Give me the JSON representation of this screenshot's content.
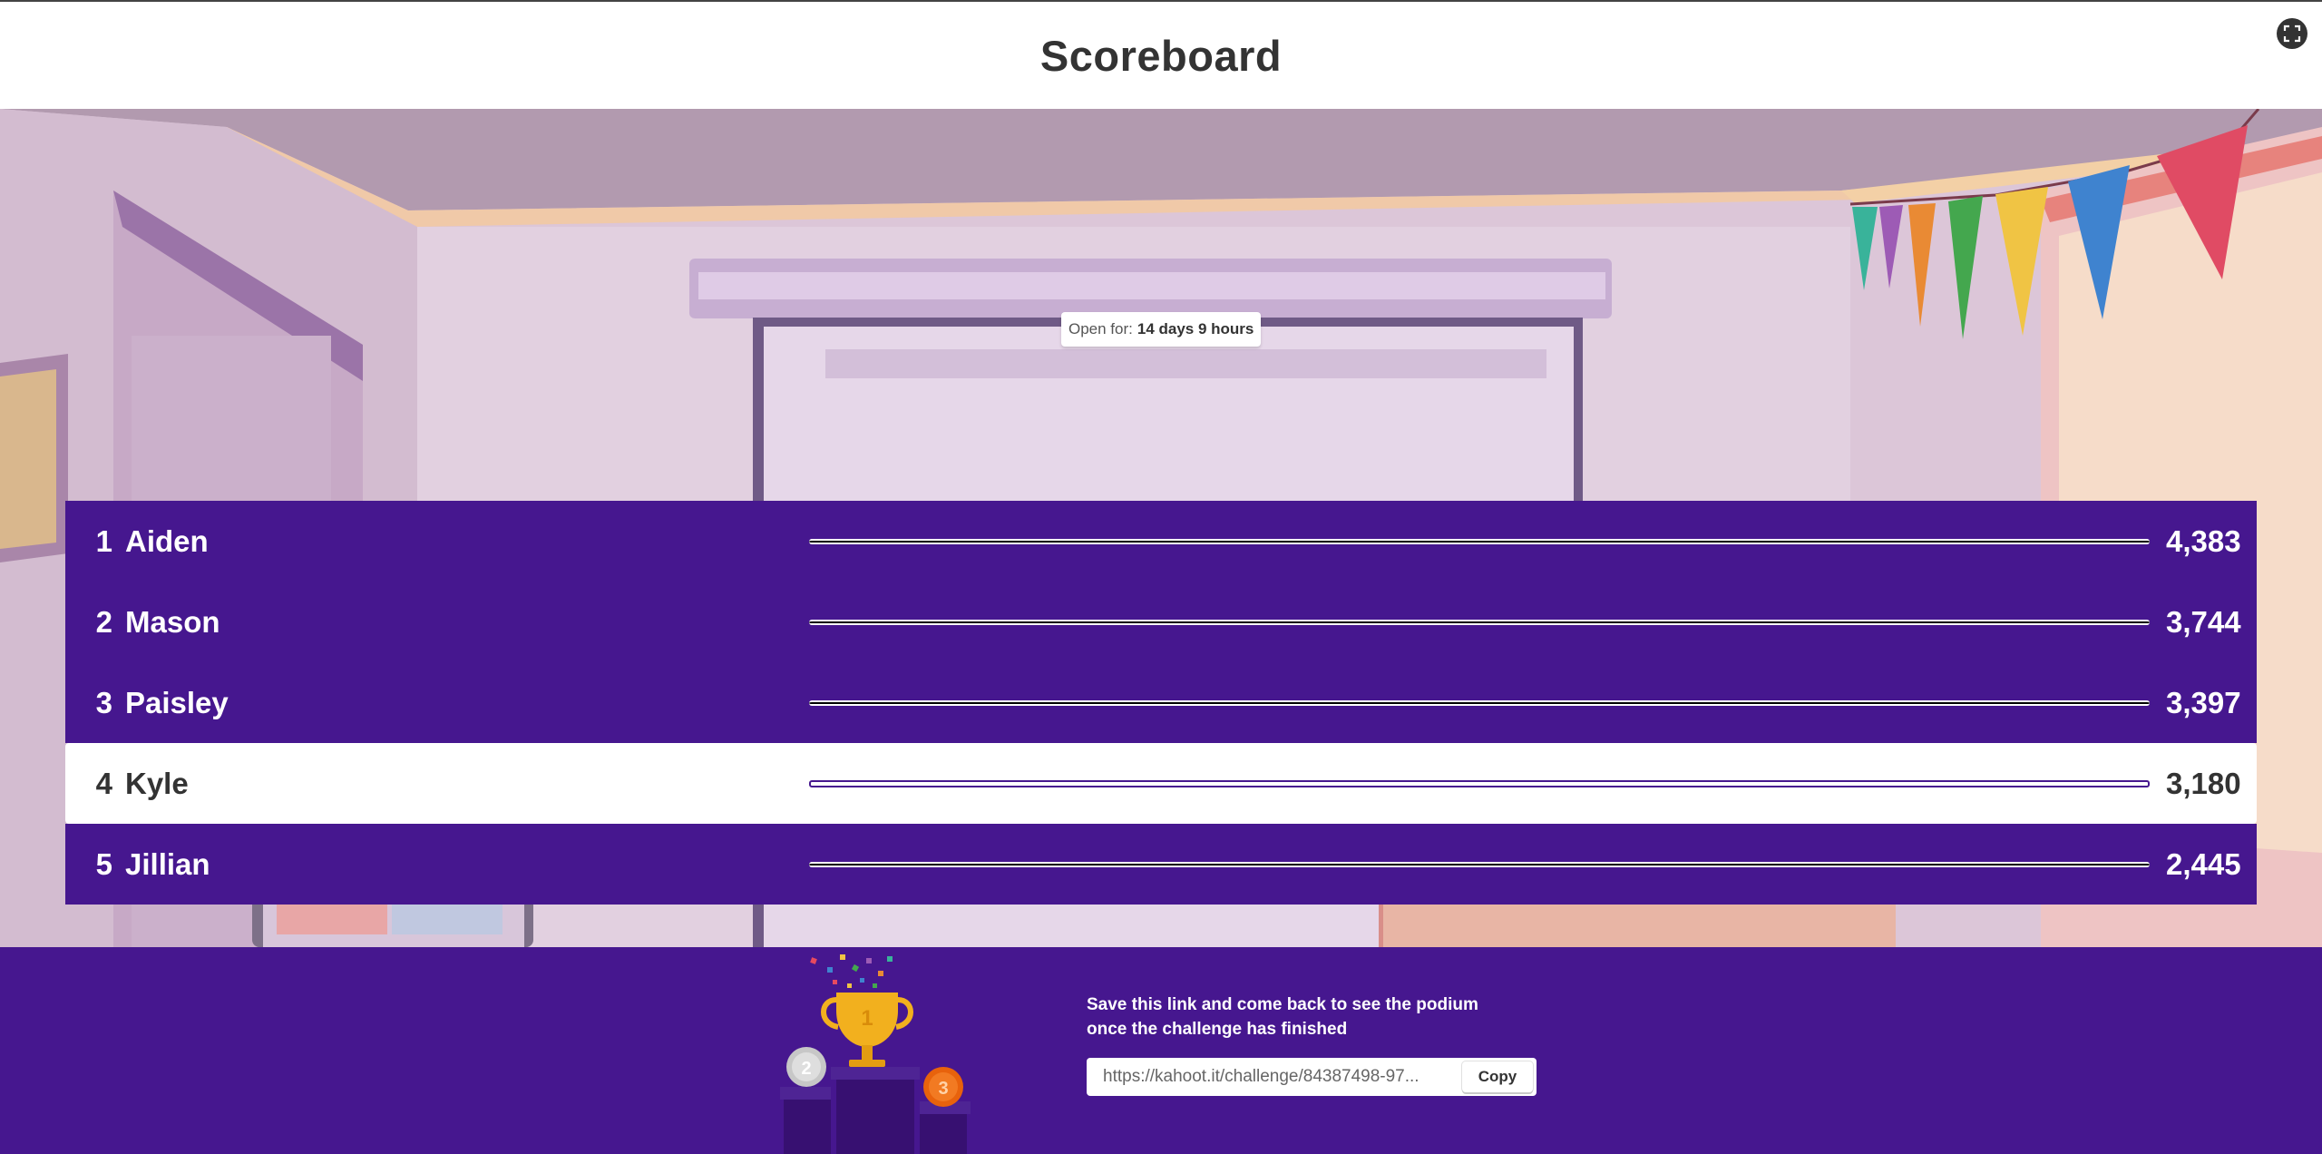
{
  "header": {
    "title": "Scoreboard"
  },
  "open_for": {
    "label": "Open for:",
    "value": "14 days 9 hours"
  },
  "scoreboard": [
    {
      "rank": "1",
      "name": "Aiden",
      "score": "4,383",
      "bar_fraction": 1.0,
      "highlighted": false
    },
    {
      "rank": "2",
      "name": "Mason",
      "score": "3,744",
      "bar_fraction": 1.0,
      "highlighted": false
    },
    {
      "rank": "3",
      "name": "Paisley",
      "score": "3,397",
      "bar_fraction": 1.0,
      "highlighted": false
    },
    {
      "rank": "4",
      "name": "Kyle",
      "score": "3,180",
      "bar_fraction": 1.0,
      "highlighted": true
    },
    {
      "rank": "5",
      "name": "Jillian",
      "score": "2,445",
      "bar_fraction": 1.0,
      "highlighted": false
    }
  ],
  "footer": {
    "message_line1": "Save this link and come back to see the podium",
    "message_line2": "once the challenge has finished",
    "link_value": "https://kahoot.it/challenge/84387498-97...",
    "copy_label": "Copy",
    "podium": {
      "first": "1",
      "second": "2",
      "third": "3"
    }
  },
  "colors": {
    "brand_purple": "#46178f",
    "gold": "#f2b01e",
    "silver": "#c7c7c7",
    "bronze": "#e8620c"
  },
  "icons": {
    "fullscreen": "fullscreen-icon",
    "trophy": "trophy-icon"
  }
}
